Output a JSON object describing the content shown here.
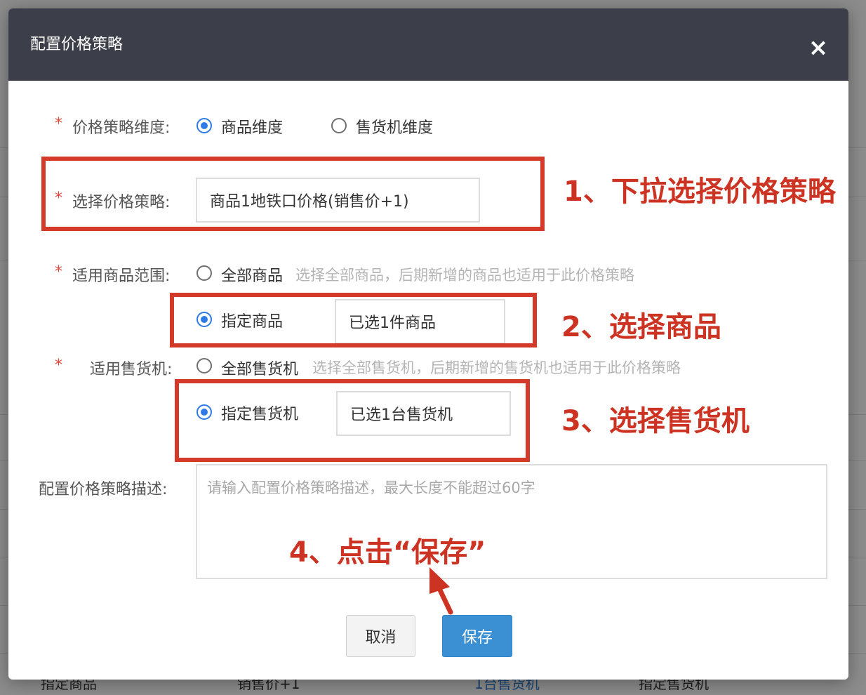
{
  "modal": {
    "title": "配置价格策略",
    "close_label": "×"
  },
  "form": {
    "dimension": {
      "label": "价格策略维度:",
      "options": [
        "商品维度",
        "售货机维度"
      ],
      "selected": "商品维度"
    },
    "strategy": {
      "label": "选择价格策略:",
      "value": "商品1地铁口价格(销售价+1)"
    },
    "goods_scope": {
      "label": "适用商品范围:",
      "all_label": "全部商品",
      "all_hint": "选择全部商品，后期新增的商品也适用于此价格策略",
      "specific_label": "指定商品",
      "specific_value": "已选1件商品",
      "selected": "指定商品"
    },
    "machine_scope": {
      "label": "适用售货机:",
      "all_label": "全部售货机",
      "all_hint": "选择全部售货机，后期新增的售货机也适用于此价格策略",
      "specific_label": "指定售货机",
      "specific_value": "已选1台售货机",
      "selected": "指定售货机"
    },
    "description": {
      "label": "配置价格策略描述:",
      "placeholder": "请输入配置价格策略描述，最大长度不能超过60字"
    },
    "required_mark": "*"
  },
  "buttons": {
    "cancel": "取消",
    "save": "保存"
  },
  "annotations": {
    "step1": "1、下拉选择价格策略",
    "step2": "2、选择商品",
    "step3": "3、选择售货机",
    "step4": "4、点击“保存”"
  },
  "background": {
    "row_text_1": "指定商品",
    "row_text_2": "销售价+1",
    "row_text_3": "1台售货机",
    "row_text_4": "指定售货机"
  },
  "colors": {
    "header_bg": "#3c3f4a",
    "annotation_red": "#cc3322",
    "radio_blue": "#2e7be6",
    "save_button": "#3b8fd3"
  }
}
